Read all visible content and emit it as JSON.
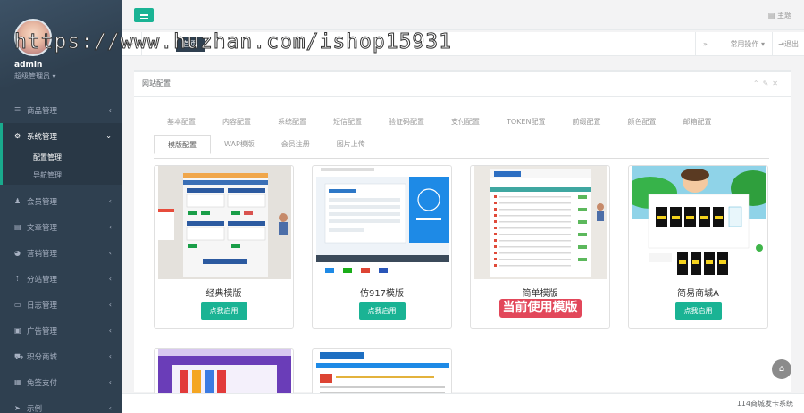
{
  "sidebar": {
    "user_name": "admin",
    "role": "超级管理员",
    "items": [
      {
        "label": "商品管理",
        "icon": "list-icon"
      },
      {
        "label": "系统管理",
        "icon": "gear-icon",
        "active": true
      },
      {
        "label": "会员管理",
        "icon": "users-icon"
      },
      {
        "label": "文章管理",
        "icon": "document-icon"
      },
      {
        "label": "营销管理",
        "icon": "chart-icon"
      },
      {
        "label": "分站管理",
        "icon": "branch-icon"
      },
      {
        "label": "日志管理",
        "icon": "log-icon"
      },
      {
        "label": "广告管理",
        "icon": "image-icon"
      },
      {
        "label": "积分商城",
        "icon": "truck-icon"
      },
      {
        "label": "免签支付",
        "icon": "pay-icon"
      },
      {
        "label": "示例",
        "icon": "send-icon"
      }
    ],
    "sub_items": [
      {
        "label": "配置管理",
        "selected": true
      },
      {
        "label": "导航管理",
        "selected": false
      }
    ]
  },
  "topbar": {
    "theme_label": "主题"
  },
  "tabsbar": {
    "home_tab": "首页",
    "ops_label": "常用操作",
    "logout_label": "退出"
  },
  "panel": {
    "title": "网站配置",
    "tabs_row1": [
      "基本配置",
      "内容配置",
      "系统配置",
      "短信配置",
      "验证码配置",
      "支付配置",
      "TOKEN配置",
      "前缀配置",
      "颜色配置",
      "邮箱配置"
    ],
    "tabs_row2": [
      "模版配置",
      "WAP模版",
      "会员注册",
      "图片上传"
    ],
    "selected_tab": "模版配置"
  },
  "templates": [
    {
      "name": "经典模版",
      "button": "点我启用",
      "current": false
    },
    {
      "name": "仿917模版",
      "button": "点我启用",
      "current": false
    },
    {
      "name": "简单模版",
      "button": "当前使用模版",
      "current": true
    },
    {
      "name": "简易商城A",
      "button": "点我启用",
      "current": false
    }
  ],
  "footer": {
    "text": "114商城发卡系统"
  },
  "watermark": "https://www.huzhan.com/ishop15931",
  "colors": {
    "sidebar": "#2f4050",
    "accent": "#1ab394",
    "current": "#e2475a"
  }
}
